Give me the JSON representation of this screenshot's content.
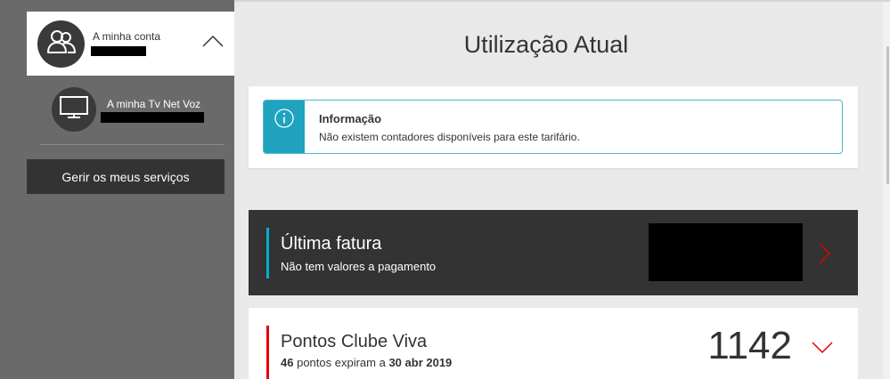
{
  "sidebar": {
    "account": {
      "name": "A minha conta",
      "icon": "people-icon"
    },
    "service": {
      "name": "A minha Tv Net Voz",
      "icon": "tv-icon"
    },
    "manage_button": "Gerir os meus serviços"
  },
  "main": {
    "title": "Utilização Atual",
    "info": {
      "title": "Informação",
      "text": "Não existem contadores disponíveis para este tarifário.",
      "icon": "info-icon"
    },
    "ultima_fatura": {
      "title": "Última fatura",
      "subtitle": "Não tem valores a pagamento"
    },
    "pontos": {
      "title": "Pontos Clube Viva",
      "expire_points": "46",
      "expire_text_1": "pontos expiram a",
      "expire_date": "30 abr 2019",
      "value": "1142"
    }
  },
  "colors": {
    "accent_cyan": "#00b0ca",
    "accent_red": "#e60000",
    "dark_card": "#333333",
    "sidebar_bg": "#6a6a6a"
  }
}
